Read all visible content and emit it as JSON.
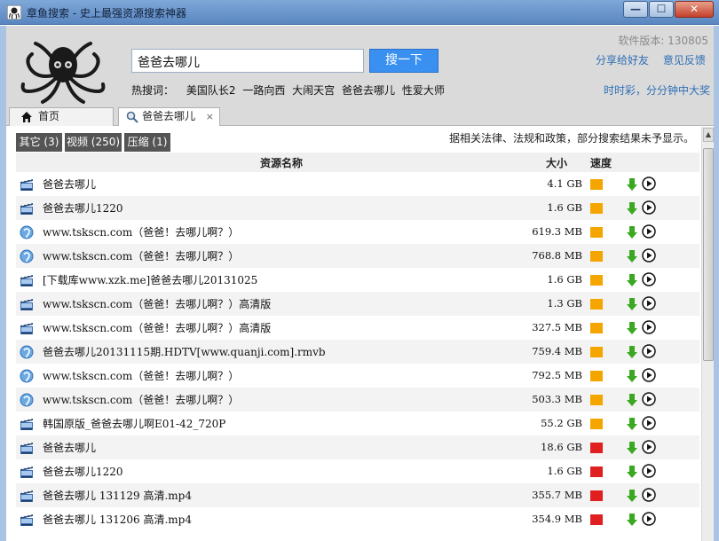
{
  "window": {
    "title": "章鱼搜索 - 史上最强资源搜索神器",
    "buttons": {
      "minimize": "—",
      "maximize": "☐",
      "close": "✕"
    }
  },
  "header": {
    "search_value": "爸爸去哪儿",
    "search_button": "搜一下",
    "hot_label": "热搜词：",
    "hot_words": [
      "美国队长2",
      "一路向西",
      "大闹天宫",
      "爸爸去哪儿",
      "性爱大师"
    ],
    "version": "软件版本: 130805",
    "share_links": [
      "分享给好友",
      "意见反馈"
    ],
    "slogan": "时时彩，分分钟中大奖"
  },
  "tabs": [
    {
      "label": "首页",
      "icon": "home-icon",
      "active": false
    },
    {
      "label": "爸爸去哪儿",
      "icon": "search-icon",
      "active": true,
      "close": "×"
    }
  ],
  "filters": [
    {
      "label": "其它 (3)"
    },
    {
      "label": "视频 (250)"
    },
    {
      "label": "压缩 (1)"
    }
  ],
  "notice": "据相关法律、法规和政策，部分搜索结果未予显示。",
  "columns": {
    "name": "资源名称",
    "size": "大小",
    "speed": "速度"
  },
  "colors": {
    "speed_fast": "#f5a500",
    "speed_slow": "#e02020",
    "accent": "#3a90f0",
    "link": "#2d6fb5",
    "chip": "#555555",
    "download_arrow": "#3aa820"
  },
  "rows": [
    {
      "icon": "video-file-icon",
      "name": "爸爸去哪儿",
      "size": "4.1 GB",
      "speed": "fast"
    },
    {
      "icon": "video-file-icon",
      "name": "爸爸去哪儿1220",
      "size": "1.6 GB",
      "speed": "fast"
    },
    {
      "icon": "web-link-icon",
      "name": "www.tskscn.com（爸爸！去哪儿啊？）",
      "size": "619.3 MB",
      "speed": "fast"
    },
    {
      "icon": "web-link-icon",
      "name": "www.tskscn.com（爸爸！去哪儿啊？）",
      "size": "768.8 MB",
      "speed": "fast"
    },
    {
      "icon": "video-file-icon",
      "name": "[下载库www.xzk.me]爸爸去哪儿20131025",
      "size": "1.6 GB",
      "speed": "fast"
    },
    {
      "icon": "video-file-icon",
      "name": "www.tskscn.com（爸爸！去哪儿啊？）高清版",
      "size": "1.3 GB",
      "speed": "fast"
    },
    {
      "icon": "video-file-icon",
      "name": "www.tskscn.com（爸爸！去哪儿啊？）高清版",
      "size": "327.5 MB",
      "speed": "fast"
    },
    {
      "icon": "web-link-icon",
      "name": "爸爸去哪儿20131115期.HDTV[www.quanji.com].rmvb",
      "size": "759.4 MB",
      "speed": "fast"
    },
    {
      "icon": "web-link-icon",
      "name": "www.tskscn.com（爸爸！去哪儿啊？）",
      "size": "792.5 MB",
      "speed": "fast"
    },
    {
      "icon": "web-link-icon",
      "name": "www.tskscn.com（爸爸！去哪儿啊？）",
      "size": "503.3 MB",
      "speed": "fast"
    },
    {
      "icon": "video-file-icon",
      "name": "韩国原版_爸爸去哪儿啊E01-42_720P",
      "size": "55.2 GB",
      "speed": "fast"
    },
    {
      "icon": "video-file-icon",
      "name": "爸爸去哪儿",
      "size": "18.6 GB",
      "speed": "slow"
    },
    {
      "icon": "video-file-icon",
      "name": "爸爸去哪儿1220",
      "size": "1.6 GB",
      "speed": "slow"
    },
    {
      "icon": "video-file-icon",
      "name": "爸爸去哪儿  131129 高清.mp4",
      "size": "355.7 MB",
      "speed": "slow"
    },
    {
      "icon": "video-file-icon",
      "name": "爸爸去哪儿  131206 高清.mp4",
      "size": "354.9 MB",
      "speed": "slow"
    }
  ]
}
